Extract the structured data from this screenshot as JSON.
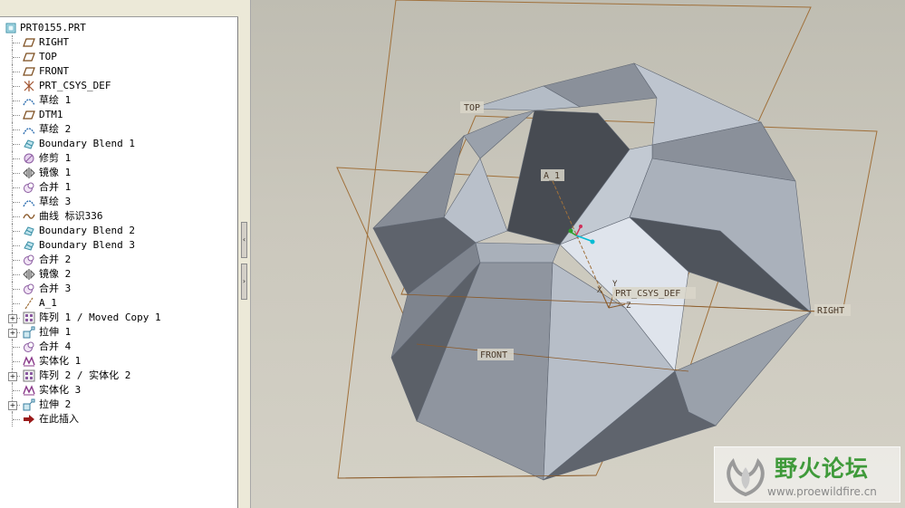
{
  "model_tree": {
    "root": {
      "label": "PRT0155.PRT",
      "icon": "part-icon"
    },
    "items": [
      {
        "label": "RIGHT",
        "icon": "datum-plane-icon",
        "expandable": false
      },
      {
        "label": "TOP",
        "icon": "datum-plane-icon",
        "expandable": false
      },
      {
        "label": "FRONT",
        "icon": "datum-plane-icon",
        "expandable": false
      },
      {
        "label": "PRT_CSYS_DEF",
        "icon": "coordinate-system-icon",
        "expandable": false
      },
      {
        "label": "草绘 1",
        "icon": "sketch-icon",
        "expandable": false
      },
      {
        "label": "DTM1",
        "icon": "datum-plane-icon",
        "expandable": false
      },
      {
        "label": "草绘 2",
        "icon": "sketch-icon",
        "expandable": false
      },
      {
        "label": "Boundary Blend 1",
        "icon": "boundary-blend-icon",
        "expandable": false
      },
      {
        "label": "修剪 1",
        "icon": "trim-icon",
        "expandable": false
      },
      {
        "label": "镜像 1",
        "icon": "mirror-icon",
        "expandable": false
      },
      {
        "label": "合并 1",
        "icon": "merge-icon",
        "expandable": false
      },
      {
        "label": "草绘 3",
        "icon": "sketch-icon",
        "expandable": false
      },
      {
        "label": "曲线 标识336",
        "icon": "curve-icon",
        "expandable": false
      },
      {
        "label": "Boundary Blend 2",
        "icon": "boundary-blend-icon",
        "expandable": false
      },
      {
        "label": "Boundary Blend 3",
        "icon": "boundary-blend-icon",
        "expandable": false
      },
      {
        "label": "合并 2",
        "icon": "merge-icon",
        "expandable": false
      },
      {
        "label": "镜像 2",
        "icon": "mirror-icon",
        "expandable": false
      },
      {
        "label": "合并 3",
        "icon": "merge-icon",
        "expandable": false
      },
      {
        "label": "A_1",
        "icon": "datum-axis-icon",
        "expandable": false
      },
      {
        "label": "阵列 1 / Moved Copy 1",
        "icon": "pattern-icon",
        "expandable": true
      },
      {
        "label": "拉伸 1",
        "icon": "extrude-icon",
        "expandable": true
      },
      {
        "label": "合并 4",
        "icon": "merge-icon",
        "expandable": false
      },
      {
        "label": "实体化 1",
        "icon": "solidify-icon",
        "expandable": false
      },
      {
        "label": "阵列 2 / 实体化 2",
        "icon": "pattern-icon",
        "expandable": true
      },
      {
        "label": "实体化 3",
        "icon": "solidify-icon",
        "expandable": false
      },
      {
        "label": "拉伸 2",
        "icon": "extrude-icon",
        "expandable": true
      },
      {
        "label": "在此插入",
        "icon": "insert-here-arrow-icon",
        "expandable": false
      }
    ]
  },
  "viewport": {
    "labels": {
      "top": "TOP",
      "front": "FRONT",
      "right": "RIGHT",
      "axis": "A_1",
      "csys": "PRT_CSYS_DEF",
      "csys_x": "X",
      "csys_y": "Y",
      "csys_z": "Z"
    }
  },
  "watermark": {
    "title": "野火论坛",
    "url": "www.proewildfire.cn"
  },
  "colors": {
    "datum_plane": "#a0703a",
    "tree_bg": "#ffffff",
    "viewport_bg": "#cbc8bd",
    "watermark_green": "#3f9a3a"
  }
}
